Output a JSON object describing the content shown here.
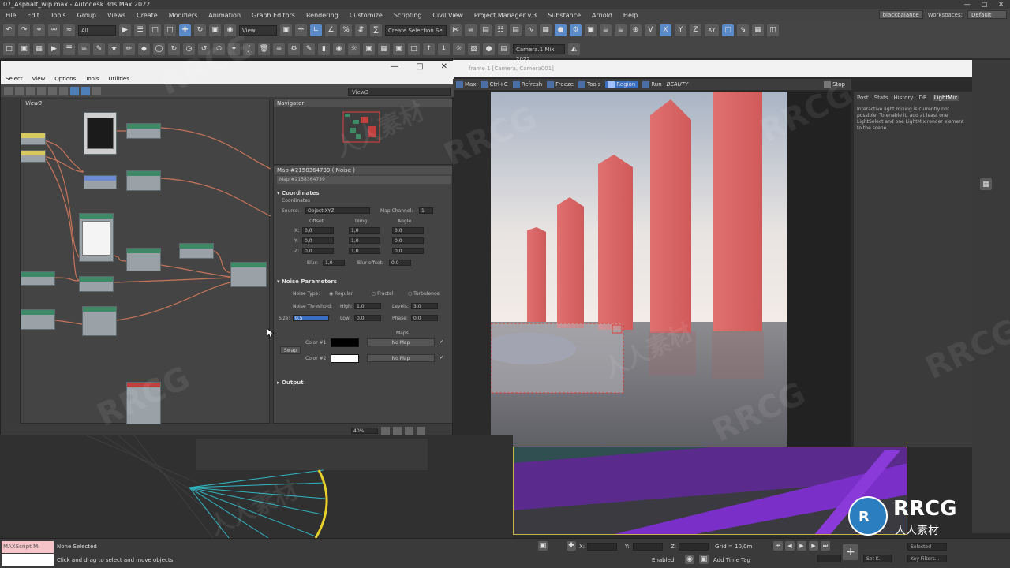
{
  "window": {
    "title": "07_Asphalt_wip.max - Autodesk 3ds Max 2022"
  },
  "menu": {
    "items": [
      "File",
      "Edit",
      "Tools",
      "Group",
      "Views",
      "Create",
      "Modifiers",
      "Animation",
      "Graph Editors",
      "Rendering",
      "Customize",
      "Scripting",
      "Civil View",
      "Project Manager v.3",
      "Substance",
      "Arnold",
      "Help"
    ],
    "user": "blackbalance",
    "workspaces_label": "Workspaces:",
    "workspace": "Default"
  },
  "toolbar": {
    "filter": "All",
    "view": "View",
    "selection_set": "Create Selection Se",
    "camera_dropdown": "Camera.1 Mix 2022",
    "axis_x": "X",
    "axis_y": "Y",
    "axis_z": "Z",
    "axis_xy": "XY"
  },
  "slate": {
    "menu": [
      "Select",
      "View",
      "Options",
      "Tools",
      "Utilities"
    ],
    "view_tab": "View3",
    "view_label": "View3",
    "navigator_title": "Navigator",
    "map_title": "Map #2158364739  ( Noise )",
    "map_name": "Map #2158364739",
    "coordinates": {
      "header": "Coordinates",
      "sub": "Coordinates",
      "source_label": "Source:",
      "source_value": "Object XYZ",
      "map_channel_label": "Map Channel:",
      "map_channel_value": "1",
      "col_offset": "Offset",
      "col_tiling": "Tiling",
      "col_angle": "Angle",
      "rows": [
        {
          "axis": "X:",
          "offset": "0,0",
          "tiling": "1,0",
          "angle": "0,0"
        },
        {
          "axis": "Y:",
          "offset": "0,0",
          "tiling": "1,0",
          "angle": "0,0"
        },
        {
          "axis": "Z:",
          "offset": "0,0",
          "tiling": "1,0",
          "angle": "0,0"
        }
      ],
      "blur_label": "Blur:",
      "blur_value": "1,0",
      "blur_offset_label": "Blur offset:",
      "blur_offset_value": "0,0"
    },
    "noise": {
      "header": "Noise Parameters",
      "type_label": "Noise Type:",
      "type_regular": "Regular",
      "type_fractal": "Fractal",
      "type_turbulence": "Turbulence",
      "threshold_label": "Noise Threshold:",
      "high_label": "High:",
      "high_value": "1,0",
      "levels_label": "Levels:",
      "levels_value": "3,0",
      "size_label": "Size:",
      "size_value": "0,5",
      "low_label": "Low:",
      "low_value": "0,0",
      "phase_label": "Phase:",
      "phase_value": "0,0",
      "maps_label": "Maps",
      "swap_label": "Swap",
      "color1_label": "Color #1",
      "color2_label": "Color #2",
      "color1_hex": "#000000",
      "color2_hex": "#ffffff",
      "no_map_1": "No Map",
      "no_map_2": "No Map"
    },
    "output_header": "Output",
    "zoom": "40%"
  },
  "vfb": {
    "toolbar": [
      "Max",
      "Ctrl+C",
      "Refresh",
      "Freeze",
      "Tools",
      "Region",
      "Run",
      "BEAUTY"
    ],
    "region_active": "Region",
    "title": "frame 1 [Camera, Camera001]",
    "stop": "Stop",
    "lightmix_tabs": [
      "Post",
      "Stats",
      "History",
      "DR",
      "LightMix"
    ],
    "lightmix_active": "LightMix",
    "lightmix_message": "Interactive light mixing is currently not possible. To enable it, add at least one LightSelect and one LightMix render element to the scene."
  },
  "status": {
    "maxscript": "MAXScript Mi",
    "selection": "None Selected",
    "prompt": "Click and drag to select and move objects",
    "x_label": "X:",
    "y_label": "Y:",
    "z_label": "Z:",
    "grid": "Grid = 10,0m",
    "enabled": "Enabled:",
    "add_time_tag": "Add Time Tag",
    "set_key": "Set K.",
    "key_filters": "Key Filters...",
    "selected": "Selected"
  },
  "watermark": {
    "text": "RRCG",
    "cn": "人人素材"
  },
  "colors": {
    "accent": "#5a8ac8",
    "node_green": "#3e8a66",
    "node_yellow": "#d8c860",
    "wire": "#c8745a"
  }
}
